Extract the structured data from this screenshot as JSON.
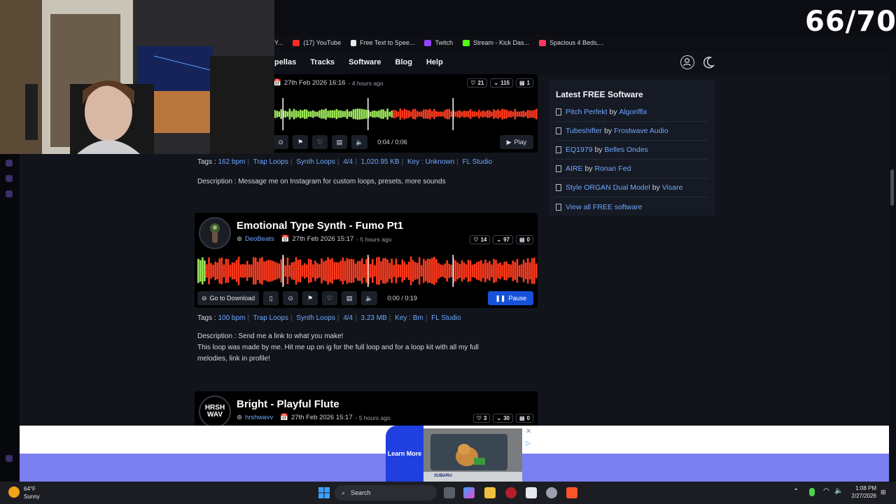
{
  "counter": "66/70",
  "bookmarks": [
    {
      "label": "Y...",
      "color": "#888888"
    },
    {
      "label": "(17) YouTube",
      "color": "#ff2a2a"
    },
    {
      "label": "Free Text to Spee...",
      "color": "#e8e8e8"
    },
    {
      "label": "Twitch",
      "color": "#9146ff"
    },
    {
      "label": "Stream - Kick Das...",
      "color": "#53fc18"
    },
    {
      "label": "Spacious 4 Beds,...",
      "color": "#ff385c"
    }
  ],
  "nav": {
    "items": [
      "pellas",
      "Tracks",
      "Software",
      "Blog",
      "Help"
    ]
  },
  "tracks": [
    {
      "title": "",
      "user": "",
      "date": "27th Feb 2026 16:16",
      "ago": "- 4 hours ago",
      "likes": "21",
      "downloads": "115",
      "comments": "1",
      "time": "0:04 / 0:06",
      "play_label": "Play",
      "progress": 0.57,
      "tags": [
        "162 bpm",
        "Trap Loops",
        "Synth Loops",
        "4/4",
        "1,020.95 KB",
        "Key : Unknown",
        "FL Studio"
      ],
      "tags_prefix": "Tags :",
      "description": "Description : Message me on Instagram for custom loops, presets, more sounds"
    },
    {
      "title": "Emotional Type Synth - Fumo Pt1",
      "user": "DeoBeats",
      "date": "27th Feb 2026 15:17",
      "ago": "- 5 hours ago",
      "likes": "14",
      "downloads": "97",
      "comments": "0",
      "goto_label": "Go to Download",
      "time": "0:00 / 0:19",
      "play_label": "Pause",
      "progress": 0.02,
      "tags": [
        "100 bpm",
        "Trap Loops",
        "Synth Loops",
        "4/4",
        "3.23 MB",
        "Key : Bm",
        "FL Studio"
      ],
      "tags_prefix": "Tags :",
      "description_lines": [
        "Description : Send me a link to what you make!",
        "This loop was made by me. Hit me up on ig for the full loop and for a loop kit with all my full",
        "melodies, link in profile!"
      ]
    },
    {
      "title": "Bright - Playful Flute",
      "user": "hrshwavv",
      "date": "27th Feb 2026 15:17",
      "ago": "- 5 hours ago",
      "likes": "3",
      "downloads": "30",
      "comments": "0",
      "avatar_text_top": "HRSH",
      "avatar_text_bottom": "WAV"
    }
  ],
  "sidebar": {
    "title": "Latest FREE Software",
    "items": [
      {
        "name": "Pitch Perfekt",
        "by": "by",
        "author": "Algoriffix"
      },
      {
        "name": "Tubeshifter",
        "by": "by",
        "author": "Frostwave Audio"
      },
      {
        "name": "EQ1979",
        "by": "by",
        "author": "Belles Ondes"
      },
      {
        "name": "AIRE",
        "by": "by",
        "author": "Ronan Fed"
      },
      {
        "name": "Style ORGAN Dual Model",
        "by": "by",
        "author": "Visare"
      }
    ],
    "view_all": "View all FREE software"
  },
  "ad": {
    "learn_more": "Learn More",
    "brand": "SUBARU"
  },
  "taskbar": {
    "weather_temp": "64°F",
    "weather_desc": "Sunny",
    "search_label": "Search",
    "time": "1:08 PM",
    "date": "2/27/2026"
  },
  "colors": {
    "wave_played": "#9ee85a",
    "wave_unplayed": "#ff3b1f",
    "accent_blue": "#1652d9",
    "link": "#6ea8ff"
  }
}
